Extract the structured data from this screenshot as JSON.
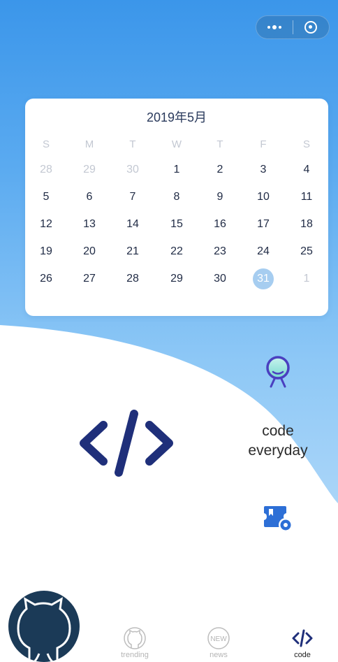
{
  "calendar": {
    "title": "2019年5月",
    "weekdays": [
      "S",
      "M",
      "T",
      "W",
      "T",
      "F",
      "S"
    ],
    "weeks": [
      [
        {
          "d": "28",
          "o": true
        },
        {
          "d": "29",
          "o": true
        },
        {
          "d": "30",
          "o": true
        },
        {
          "d": "1"
        },
        {
          "d": "2"
        },
        {
          "d": "3"
        },
        {
          "d": "4"
        }
      ],
      [
        {
          "d": "5"
        },
        {
          "d": "6"
        },
        {
          "d": "7"
        },
        {
          "d": "8"
        },
        {
          "d": "9"
        },
        {
          "d": "10"
        },
        {
          "d": "11"
        }
      ],
      [
        {
          "d": "12"
        },
        {
          "d": "13"
        },
        {
          "d": "14"
        },
        {
          "d": "15"
        },
        {
          "d": "16"
        },
        {
          "d": "17"
        },
        {
          "d": "18"
        }
      ],
      [
        {
          "d": "19"
        },
        {
          "d": "20"
        },
        {
          "d": "21"
        },
        {
          "d": "22"
        },
        {
          "d": "23"
        },
        {
          "d": "24"
        },
        {
          "d": "25"
        }
      ],
      [
        {
          "d": "26"
        },
        {
          "d": "27"
        },
        {
          "d": "28"
        },
        {
          "d": "29"
        },
        {
          "d": "30"
        },
        {
          "d": "31",
          "today": true
        },
        {
          "d": "1",
          "o": true
        }
      ]
    ]
  },
  "motto": {
    "line1": "code",
    "line2": "everyday"
  },
  "tabs": [
    {
      "label": "trending",
      "icon": "github-icon",
      "active": false
    },
    {
      "label": "news",
      "icon": "new-badge-icon",
      "active": false,
      "badge": "NEW"
    },
    {
      "label": "code",
      "icon": "code-icon",
      "active": true
    }
  ],
  "colors": {
    "gradient_top": "#3b96ea",
    "gradient_bottom": "#c9e4fb",
    "brand_navy": "#1f2f7a",
    "robot_purple": "#4a3fc0",
    "ticket_blue": "#2d6fd6",
    "today_highlight": "#a6cdf0"
  }
}
